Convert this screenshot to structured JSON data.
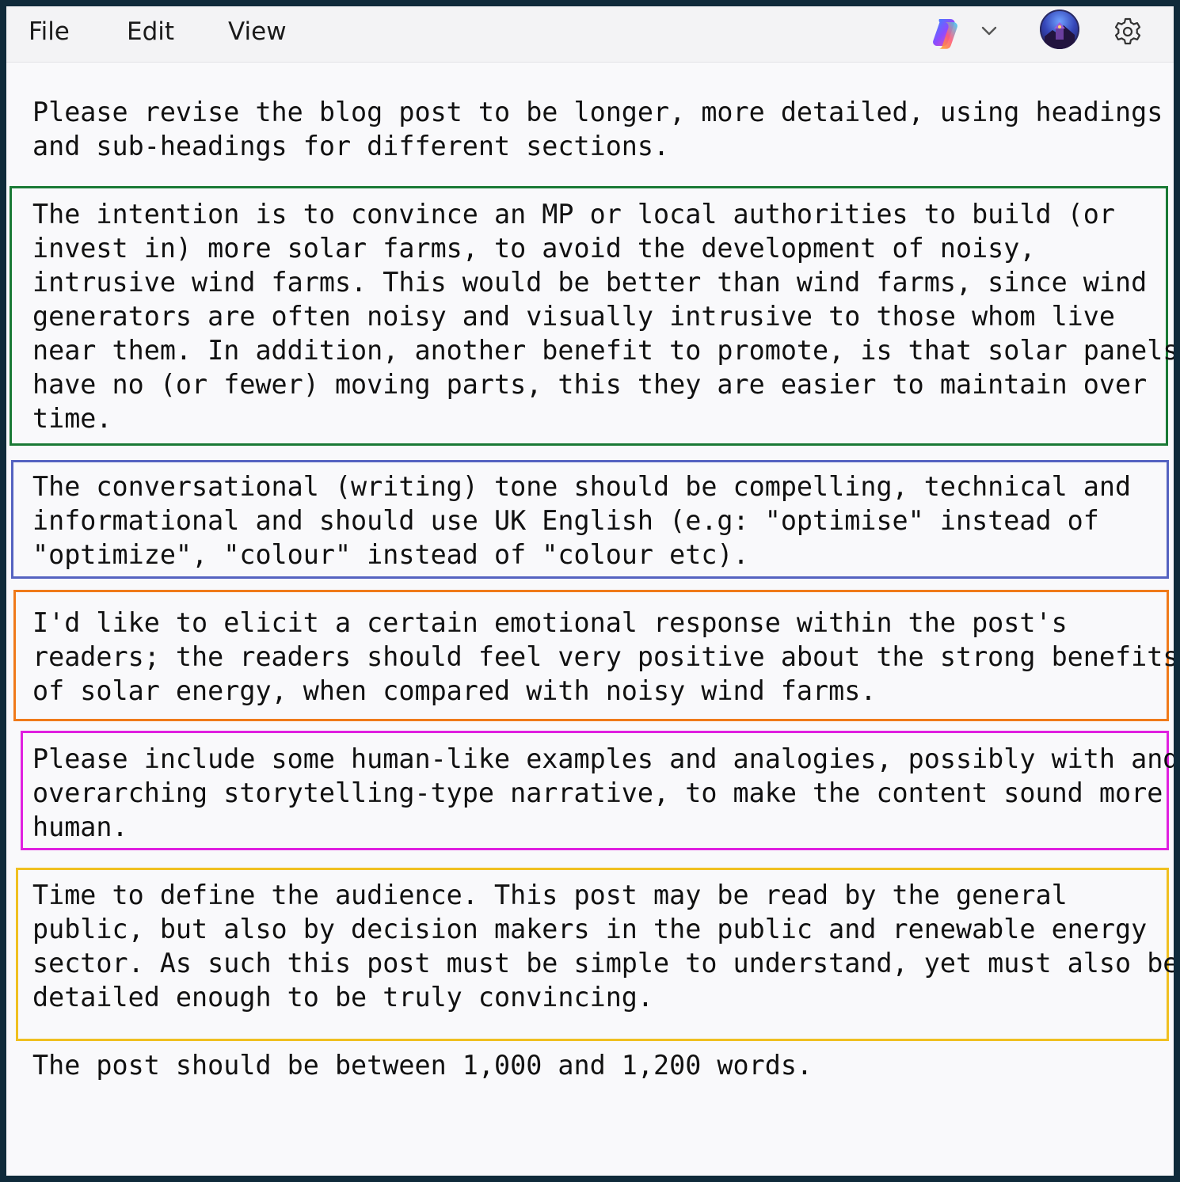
{
  "menu": {
    "file": "File",
    "edit": "Edit",
    "view": "View"
  },
  "toolbar": {
    "copilot_icon": "copilot-icon",
    "chevron_icon": "chevron-down-icon",
    "avatar_icon": "user-avatar",
    "settings_icon": "gear-icon"
  },
  "colors": {
    "green_box": "#1a7a35",
    "blue_box": "#5563c1",
    "orange_box": "#f07a1a",
    "magenta_box": "#e020e0",
    "yellow_box": "#f0c020"
  },
  "document": {
    "p1": "Please revise the blog post to be longer, more detailed, using headings\nand sub-headings for different sections.",
    "p2": "The intention is to convince an MP or local authorities to build (or\ninvest in) more solar farms, to avoid the development of noisy,\nintrusive wind farms. This would be better than wind farms, since wind\ngenerators are often noisy and visually intrusive to those whom live\nnear them. In addition, another benefit to promote, is that solar panels\nhave no (or fewer) moving parts, this they are easier to maintain over\ntime.",
    "p3": "The conversational (writing) tone should be compelling, technical and\ninformational and should use UK English (e.g: \"optimise\" instead of\n\"optimize\", \"colour\" instead of \"colour etc).",
    "p4": "I'd like to elicit a certain emotional response within the post's\nreaders; the readers should feel very positive about the strong benefits\nof solar energy, when compared with noisy wind farms.",
    "p5": "Please include some human-like examples and analogies, possibly with and\noverarching storytelling-type narrative, to make the content sound more\nhuman.",
    "p6": "Time to define the audience. This post may be read by the general\npublic, but also by decision makers in the public and renewable energy\nsector. As such this post must be simple to understand, yet must also be\ndetailed enough to be truly convincing.",
    "p7": "The post should be between 1,000 and 1,200 words."
  }
}
